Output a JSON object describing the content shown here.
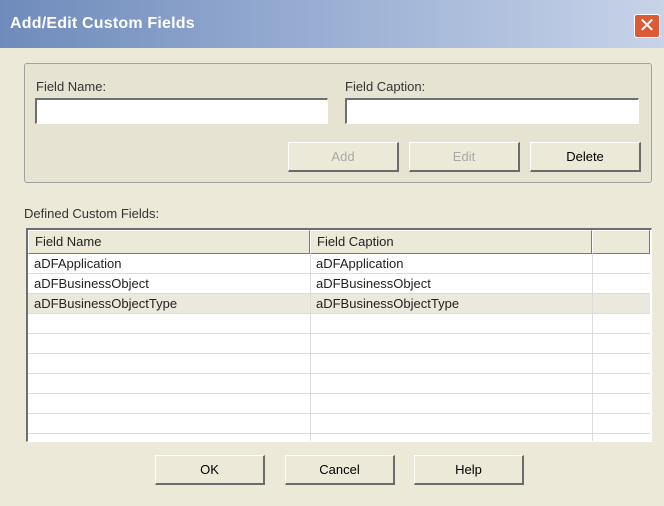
{
  "window": {
    "title": "Add/Edit Custom Fields",
    "close_glyph": "✕"
  },
  "form": {
    "field_name_label": "Field Name:",
    "field_name_value": "",
    "field_caption_label": "Field Caption:",
    "field_caption_value": "",
    "add_label": "Add",
    "edit_label": "Edit",
    "delete_label": "Delete"
  },
  "list": {
    "label": "Defined Custom Fields:",
    "columns": [
      "Field Name",
      "Field Caption",
      ""
    ],
    "rows": [
      {
        "name": "aDFApplication",
        "caption": "aDFApplication"
      },
      {
        "name": "aDFBusinessObject",
        "caption": "aDFBusinessObject"
      },
      {
        "name": "aDFBusinessObjectType",
        "caption": "aDFBusinessObjectType"
      }
    ],
    "selected_row": 2
  },
  "footer": {
    "ok_label": "OK",
    "cancel_label": "Cancel",
    "help_label": "Help"
  },
  "colors": {
    "dialog_bg": "#ece9d8",
    "title_bar": "#6f8bbb",
    "close_button": "#dd5a36"
  },
  "icons": {
    "close": "close-icon"
  }
}
